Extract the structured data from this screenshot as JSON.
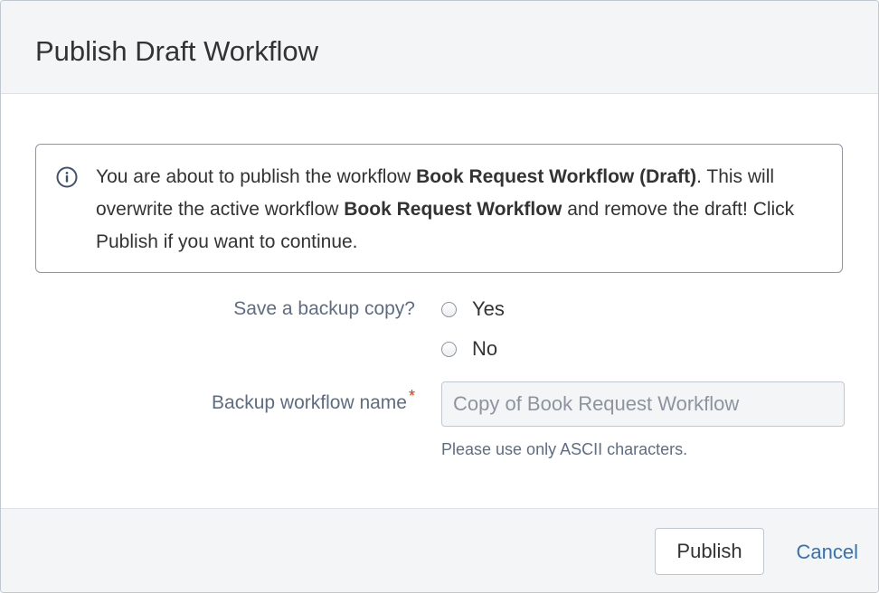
{
  "dialog": {
    "title": "Publish Draft Workflow"
  },
  "info": {
    "icon": "info-icon",
    "text_1": "You are about to publish the workflow ",
    "draft_workflow_name": "Book Request Workflow (Draft)",
    "text_2": ". This will overwrite the active workflow ",
    "active_workflow_name": "Book Request Workflow",
    "text_3": " and remove the draft! Click Publish if you want to continue."
  },
  "form": {
    "backup_label": "Save a backup copy?",
    "options": [
      {
        "label": "Yes",
        "selected": false
      },
      {
        "label": "No",
        "selected": false
      }
    ],
    "workflow_name_label": "Backup workflow name",
    "required_mark": "*",
    "workflow_name_value": "Copy of Book Request Workflow",
    "help_text": "Please use only ASCII characters."
  },
  "footer": {
    "publish_label": "Publish",
    "cancel_label": "Cancel"
  },
  "colors": {
    "link": "#3572b0",
    "required": "#de350b",
    "info_border": "#8a96ab"
  }
}
